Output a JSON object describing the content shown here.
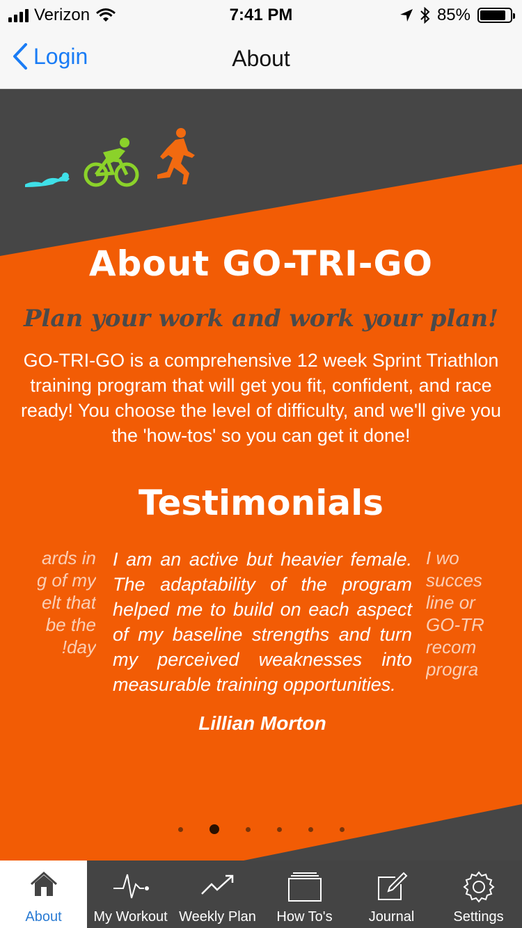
{
  "status_bar": {
    "carrier": "Verizon",
    "time": "7:41 PM",
    "battery": "85%",
    "battery_level": 0.85
  },
  "nav": {
    "back_label": "Login",
    "title": "About"
  },
  "about": {
    "heading": "About GO-TRI-GO",
    "tagline": "Plan your work and work your plan!",
    "body": "GO-TRI-GO is a comprehensive 12 week Sprint Triathlon training program that will get you fit, confident, and race ready! You choose the level of difficulty, and we'll give you the 'how-tos' so you can get it done!"
  },
  "testimonials": {
    "heading": "Testimonials",
    "prev_lines": [
      "ards in",
      "g of my",
      "elt that",
      "be the",
      "day!"
    ],
    "current": {
      "quote": "I am an active but heavier female. The adaptability of the program helped me to build on each aspect of my baseline strengths and turn my perceived weaknesses into measurable training opportunities.",
      "author": "Lillian Morton"
    },
    "next_lines": [
      "I wo",
      "succes",
      "line or",
      "GO-TR",
      "recom",
      "progra"
    ],
    "page_count": 6,
    "active_page": 2
  },
  "tabs": [
    {
      "label": "About",
      "icon": "home-icon",
      "active": true
    },
    {
      "label": "My Workout",
      "icon": "heartbeat-icon",
      "active": false
    },
    {
      "label": "Weekly Plan",
      "icon": "trend-chart-icon",
      "active": false
    },
    {
      "label": "How To's",
      "icon": "stacked-pages-icon",
      "active": false
    },
    {
      "label": "Journal",
      "icon": "edit-note-icon",
      "active": false
    },
    {
      "label": "Settings",
      "icon": "gear-icon",
      "active": false
    }
  ],
  "colors": {
    "accent_blue": "#1a7cf5",
    "orange": "#f25c05",
    "dark_gray": "#464646",
    "swim": "#3fe0e8",
    "bike": "#8bd22a",
    "run": "#f26a10"
  }
}
